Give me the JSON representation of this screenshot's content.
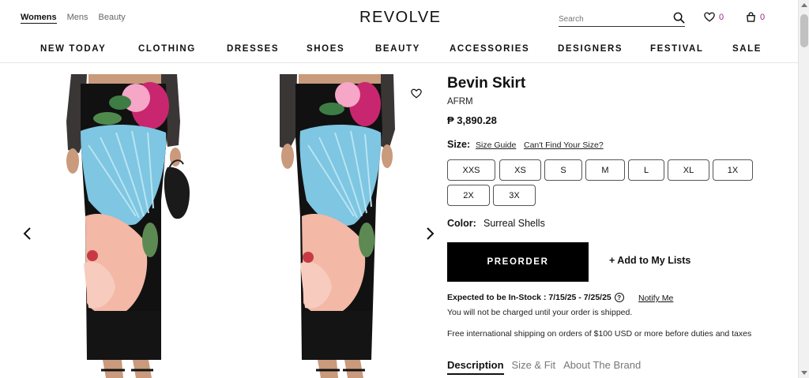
{
  "header": {
    "gender_tabs": [
      "Womens",
      "Mens",
      "Beauty"
    ],
    "logo": "REVOLVE",
    "search_placeholder": "Search",
    "wishlist_count": "0",
    "bag_count": "0",
    "accent_color": "#a0258a"
  },
  "nav": [
    "NEW TODAY",
    "CLOTHING",
    "DRESSES",
    "SHOES",
    "BEAUTY",
    "ACCESSORIES",
    "DESIGNERS",
    "FESTIVAL",
    "SALE"
  ],
  "product": {
    "title": "Bevin Skirt",
    "brand": "AFRM",
    "price": "₱ 3,890.28",
    "size_label": "Size:",
    "size_guide": "Size Guide",
    "cant_find": "Can't Find Your Size?",
    "sizes": [
      "XXS",
      "XS",
      "S",
      "M",
      "L",
      "XL",
      "1X",
      "2X",
      "3X"
    ],
    "color_label": "Color:",
    "color_value": "Surreal Shells",
    "preorder": "PREORDER",
    "add_lists": "+ Add to My Lists",
    "expected": "Expected to be In-Stock : 7/15/25 - 7/25/25",
    "notify": "Notify Me",
    "charged_note": "You will not be charged until your order is shipped.",
    "shipping_note": "Free international shipping on orders of $100 USD or more before duties and taxes"
  },
  "tabs": [
    "Description",
    "Size & Fit",
    "About The Brand"
  ]
}
